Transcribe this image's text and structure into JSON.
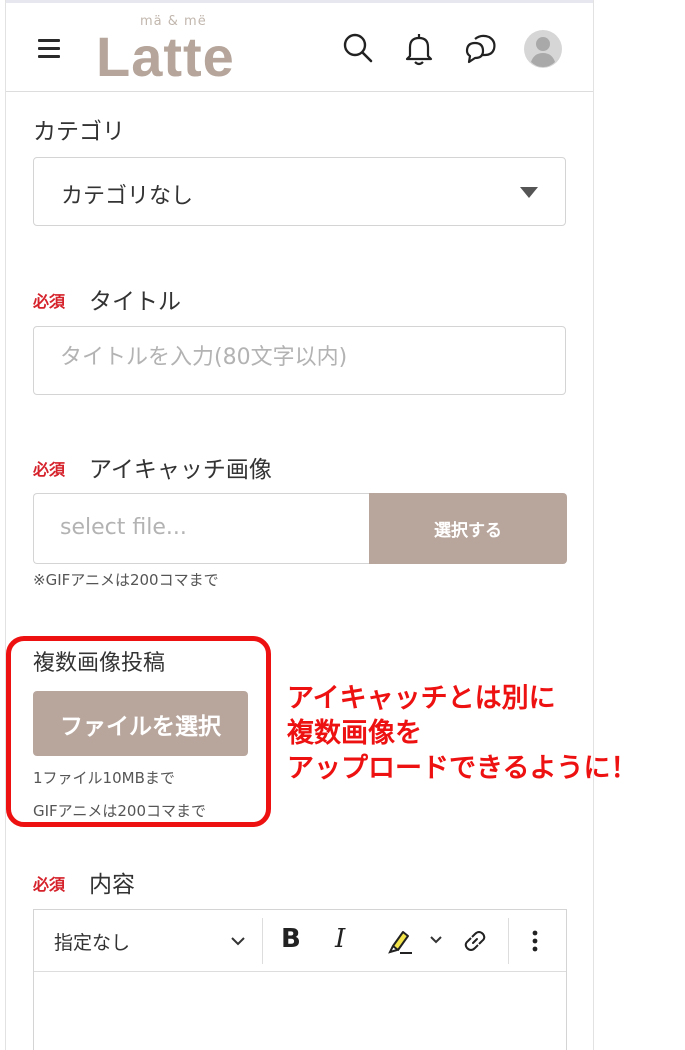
{
  "header": {
    "logo_sub": "mä & më",
    "logo_main": "Latte",
    "icons": [
      "menu-icon",
      "search-icon",
      "bell-icon",
      "chat-icon",
      "avatar-icon"
    ]
  },
  "category": {
    "label": "カテゴリ",
    "selected": "カテゴリなし"
  },
  "title_field": {
    "required": "必須",
    "label": "タイトル",
    "placeholder": "タイトルを入力(80文字以内)"
  },
  "eyecatch": {
    "required": "必須",
    "label": "アイキャッチ画像",
    "placeholder": "select file...",
    "button": "選択する",
    "note": "※GIFアニメは200コマまで"
  },
  "multi_image": {
    "label": "複数画像投稿",
    "button": "ファイルを選択",
    "note1": "1ファイル10MBまで",
    "note2": "GIFアニメは200コマまで"
  },
  "annotation": {
    "line1": "アイキャッチとは別に",
    "line2": "複数画像を",
    "line3": "アップロードできるように！",
    "color": "#ee1111"
  },
  "content": {
    "required": "必須",
    "label": "内容",
    "format_select": "指定なし",
    "toolbar_icons": [
      "bold-icon",
      "italic-icon",
      "highlight-icon",
      "link-icon",
      "more-icon"
    ]
  },
  "colors": {
    "accent": "#b8a69d",
    "required": "#d5222b"
  }
}
